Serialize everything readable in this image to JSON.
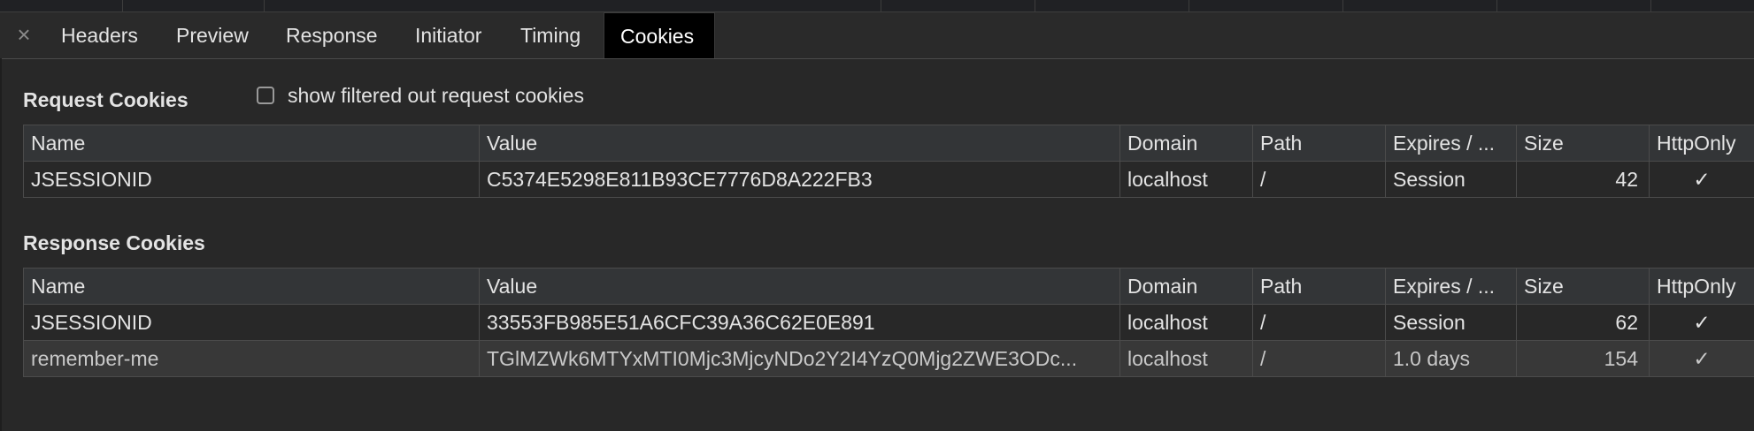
{
  "tabs": {
    "close_symbol": "×",
    "items": [
      {
        "label": "Headers"
      },
      {
        "label": "Preview"
      },
      {
        "label": "Response"
      },
      {
        "label": "Initiator"
      },
      {
        "label": "Timing"
      },
      {
        "label": "Cookies",
        "active": true
      }
    ]
  },
  "request_cookies": {
    "title": "Request Cookies",
    "filter_checkbox": {
      "label": "show filtered out request cookies",
      "checked": false
    },
    "columns": [
      "Name",
      "Value",
      "Domain",
      "Path",
      "Expires / ...",
      "Size",
      "HttpOnly"
    ],
    "rows": [
      {
        "name": "JSESSIONID",
        "value": "C5374E5298E811B93CE7776D8A222FB3",
        "domain": "localhost",
        "path": "/",
        "expires": "Session",
        "size": "42",
        "httponly": "✓"
      }
    ]
  },
  "response_cookies": {
    "title": "Response Cookies",
    "columns": [
      "Name",
      "Value",
      "Domain",
      "Path",
      "Expires / ...",
      "Size",
      "HttpOnly"
    ],
    "rows": [
      {
        "name": "JSESSIONID",
        "value": "33553FB985E51A6CFC39A36C62E0E891",
        "domain": "localhost",
        "path": "/",
        "expires": "Session",
        "size": "62",
        "httponly": "✓"
      },
      {
        "name": "remember-me",
        "value": "TGlMZWk6MTYxMTI0Mjc3MjcyNDo2Y2I4YzQ0Mjg2ZWE3ODc...",
        "domain": "localhost",
        "path": "/",
        "expires": "1.0 days",
        "size": "154",
        "httponly": "✓"
      }
    ]
  },
  "colors": {
    "panel_bg": "#282828",
    "active_tab_bg": "#000000",
    "header_row_bg": "#333537",
    "selected_row_bg": "#383838",
    "grid_line": "#4b4b4b"
  }
}
